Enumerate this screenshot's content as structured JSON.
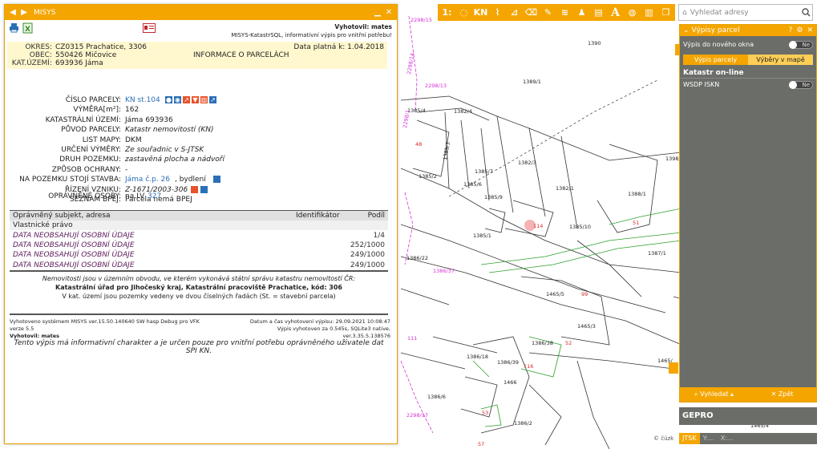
{
  "left_panel": {
    "title": "MISYS",
    "report_header": {
      "author_label": "Vyhotovil: mates",
      "subtitle": "MISYS-KatastrSQL, informativní výpis pro vnitřní potřebu!"
    },
    "okres_label": "OKRES:",
    "okres_value": "CZ0315 Prachatice, 3306",
    "obec_label": "OBEC:",
    "obec_value": "550426 Mičovice",
    "katuzemi_label": "KAT.ÚZEMÍ:",
    "katuzemi_value": "693936 Jáma",
    "valid_date": "Data platná k: 1.04.2018",
    "report_title": "INFORMACE O PARCELÁCH",
    "properties": [
      {
        "label": "ČÍSLO PARCELY:",
        "value": "KN st.104"
      },
      {
        "label": "VÝMĚRA[m²]:",
        "value": "162"
      },
      {
        "label": "KATASTRÁLNÍ ÚZEMÍ:",
        "value": "Jáma 693936"
      },
      {
        "label": "PŮVOD PARCELY:",
        "value": "Katastr nemovitostí (KN)"
      },
      {
        "label": "LIST MAPY:",
        "value": "DKM"
      },
      {
        "label": "URČENÍ VÝMĚRY:",
        "value": "Ze souřadnic v S-JTSK"
      },
      {
        "label": "DRUH POZEMKU:",
        "value": "zastavěná plocha a nádvoří"
      },
      {
        "label": "ZPŮSOB OCHRANY:",
        "value": "-"
      },
      {
        "label": "NA POZEMKU STOJÍ STAVBA:",
        "value": "Jáma č.p. 26",
        "value2": ", bydlení"
      },
      {
        "label": "ŘÍZENÍ VZNIKU:",
        "value": "Z-1671/2003-306"
      },
      {
        "label": "SEZNAM BPEJ:",
        "value": "Parcela nemá BPEJ"
      }
    ],
    "opravnene_label": "OPRÁVNĚNÉ OSOBY:",
    "opravnene_value": "na LV",
    "lv_number": "327",
    "table_headers": {
      "subject": "Oprávněný subjekt, adresa",
      "identifier": "Identifikátor",
      "share": "Podíl"
    },
    "table_section": "Vlastnické právo",
    "owners": [
      {
        "name": "DATA NEOBSAHUJÍ OSOBNÍ ÚDAJE",
        "share": "1/4"
      },
      {
        "name": "DATA NEOBSAHUJÍ OSOBNÍ ÚDAJE",
        "share": "252/1000"
      },
      {
        "name": "DATA NEOBSAHUJÍ OSOBNÍ ÚDAJE",
        "share": "249/1000"
      },
      {
        "name": "DATA NEOBSAHUJÍ OSOBNÍ ÚDAJE",
        "share": "249/1000"
      }
    ],
    "office_note": "Nemovitosti jsou v územním obvodu, ve kterém vykonává státní správu katastru nemovitostí ČR:",
    "office_name": "Katastrální úřad pro Jihočeský kraj, Katastrální pracoviště Prachatice, kód: 306",
    "office_note2": "V kat. území jsou pozemky vedeny ve dvou číselných řadách (St. = stavební parcela)",
    "footer": {
      "system": "Vyhotoveno systémem MISYS ver.15.50.140640 SW hasp Debug pro VFK",
      "datetime": "Datum a čas vyhotovení výpisu: 29.09.2021 10:08:47",
      "version": "verze 5.5",
      "duration": "Výpis vyhotoven za 0.545s, SQLite3 native,",
      "sqlite": "ver.3.35.5.138576",
      "author": "Vyhotovil: mates",
      "disclaimer": "Tento výpis má informativní charakter a je určen pouze pro vnitřní potřebu oprávněného uživatele dat SPI KN."
    }
  },
  "toolbar": {
    "icons": [
      "1:n-icon",
      "speech-bubble-icon",
      "kn-icon",
      "chart-icon",
      "measure-icon",
      "erase-icon",
      "pencil-icon",
      "layers-icon",
      "person-icon",
      "print-icon",
      "text-icon",
      "globe-icon",
      "map-icon",
      "book-icon"
    ],
    "kn_label": "KN",
    "scale_label": "1:",
    "text_label": "A"
  },
  "search": {
    "placeholder": "Vyhledat adresy"
  },
  "right_panel": {
    "title": "Výpisy parcel",
    "new_window_label": "Výpis do nového okna",
    "toggle_no": "Ne",
    "tab1": "Výpis parcely",
    "tab2": "Výběry v mapě",
    "section": "Katastr on-line",
    "wsdp_label": "WSDP ISKN",
    "search_btn": "Vyhledat ▴",
    "close_btn": "Zpět"
  },
  "gepro": "GEPRO",
  "cuzk": "© čúzk",
  "coord": {
    "system": "JTSK",
    "x": "Y:...",
    "y": "X:..."
  },
  "map_labels": [
    "1390",
    "1389/1",
    "1385/4",
    "1382/4",
    "1385/3",
    "1382/3",
    "1385/7",
    "1385/6",
    "1385/9",
    "1382/1",
    "48",
    "1385/2",
    "114",
    "1385/1",
    "1385/10",
    "1386/22",
    "1388/1",
    "1398/",
    "51",
    "1387/1",
    "99",
    "1465/5",
    "1465/3",
    "52",
    "1386/38",
    "1386/39",
    "116",
    "1466",
    "1386/18",
    "1386/2",
    "57",
    "1386/17",
    "2298/15",
    "2298/14",
    "2298/13",
    "2298/17",
    "1386/37",
    "1386/22",
    "1465/4",
    "1386/6",
    "107",
    "101"
  ],
  "colors": {
    "accent": "#f5a500",
    "panel": "#6b6d68"
  }
}
